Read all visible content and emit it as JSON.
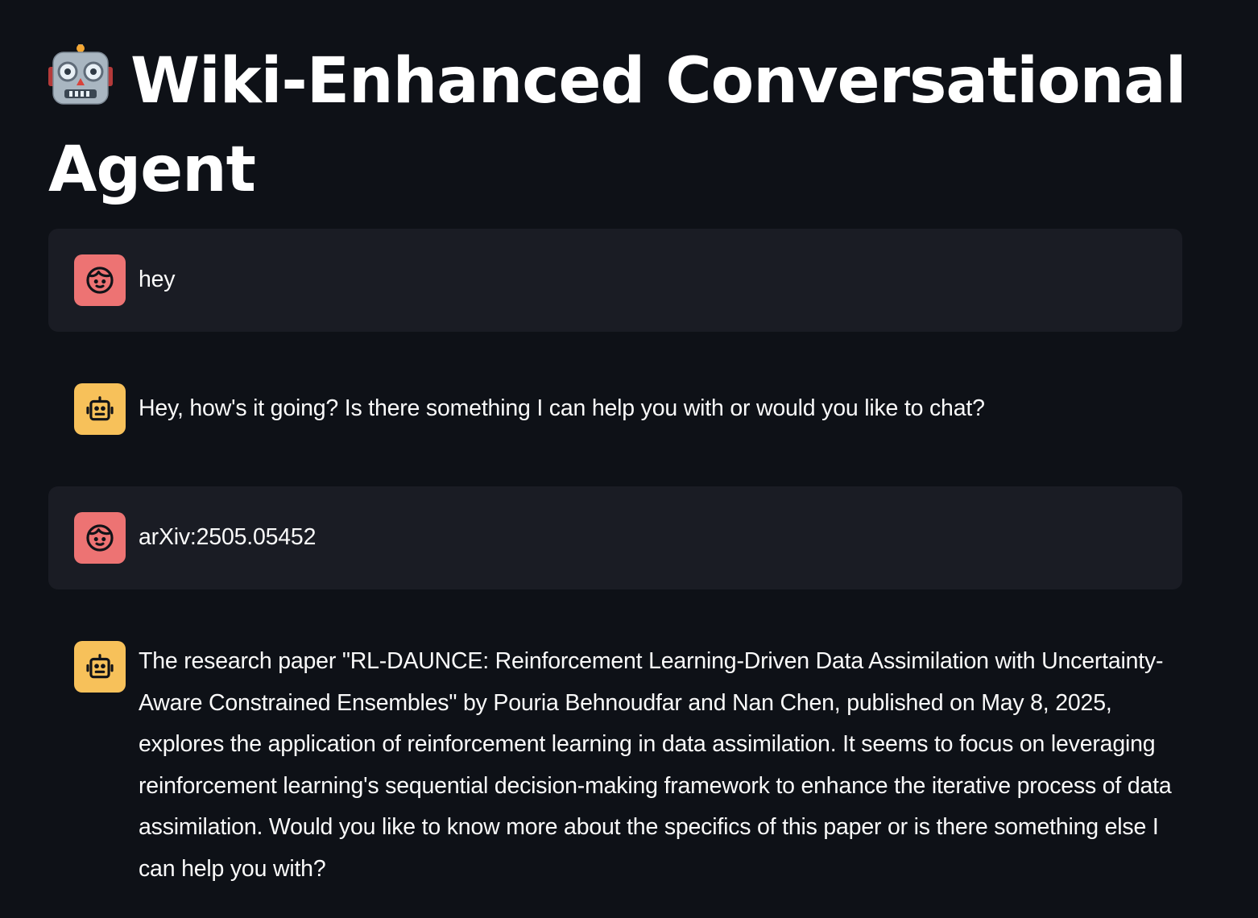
{
  "header": {
    "title": "Wiki-Enhanced Conversational Agent",
    "title_icon": "robot-face-emoji"
  },
  "messages": [
    {
      "role": "user",
      "avatar_icon": "user-face-icon",
      "text": "hey"
    },
    {
      "role": "assistant",
      "avatar_icon": "bot-icon",
      "text": "Hey, how's it going? Is there something I can help you with or would you like to chat?"
    },
    {
      "role": "user",
      "avatar_icon": "user-face-icon",
      "text": "arXiv:2505.05452"
    },
    {
      "role": "assistant",
      "avatar_icon": "bot-icon",
      "text": "The research paper \"RL-DAUNCE: Reinforcement Learning-Driven Data Assimilation with Uncertainty-Aware Constrained Ensembles\" by Pouria Behnoudfar and Nan Chen, published on May 8, 2025, explores the application of reinforcement learning in data assimilation. It seems to focus on leveraging reinforcement learning's sequential decision-making framework to enhance the iterative process of data assimilation. Would you like to know more about the specifics of this paper or is there something else I can help you with?"
    }
  ],
  "colors": {
    "background": "#0e1117",
    "user_message_bg": "#1a1c24",
    "user_avatar": "#ed7373",
    "assistant_avatar": "#f7c15a",
    "text": "#fafafa"
  }
}
